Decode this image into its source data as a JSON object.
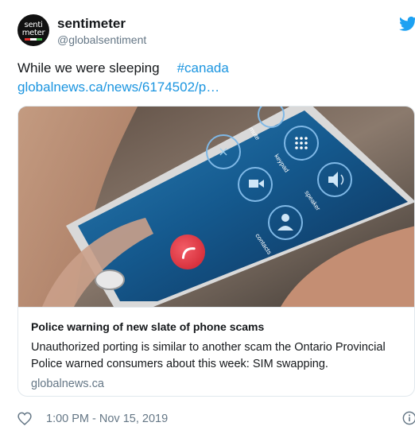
{
  "author": {
    "avatar": {
      "line1": "senti",
      "line2": "meter"
    },
    "name": "sentimeter",
    "handle": "@globalsentiment"
  },
  "tweet": {
    "text": "While we were sleeping",
    "hashtag": "#canada",
    "link": "globalnews.ca/news/6174502/p…"
  },
  "card": {
    "image_labels": {
      "mute": "mute",
      "keypad": "keypad",
      "speaker": "speaker",
      "contacts": "contacts"
    },
    "title": "Police warning of new slate of phone scams",
    "description": "Unauthorized porting is similar to another scam the Ontario Provincial Police warned consumers about this week: SIM swapping.",
    "domain": "globalnews.ca"
  },
  "footer": {
    "timestamp": "1:00 PM - Nov 15, 2019"
  },
  "icons": {
    "brand": "twitter-bird-icon",
    "like": "heart-icon",
    "info": "info-icon"
  },
  "colors": {
    "link": "#1b95e0",
    "secondary_text": "#657786",
    "border": "#e1e8ed",
    "end_call": "#e8434f"
  }
}
